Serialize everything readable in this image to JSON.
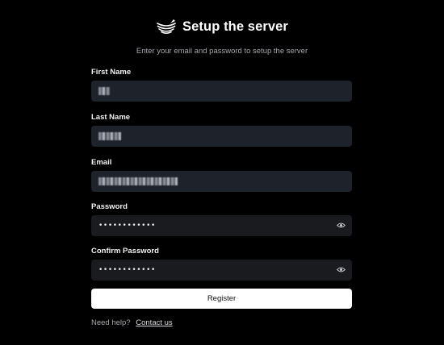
{
  "header": {
    "title": "Setup the server",
    "logo_icon": "layered-bowl-logo-icon"
  },
  "subtitle": "Enter your email and password to setup the server",
  "fields": [
    {
      "label": "First Name",
      "value": "",
      "value_obscured": true
    },
    {
      "label": "Last Name",
      "value": "",
      "value_obscured": true
    },
    {
      "label": "Email",
      "value": "",
      "value_obscured": true
    },
    {
      "label": "Password",
      "value": "••••••••••••",
      "toggle_icon": "eye-icon"
    },
    {
      "label": "Confirm Password",
      "value": "••••••••••••",
      "toggle_icon": "eye-icon"
    }
  ],
  "register_label": "Register",
  "help": {
    "prefix": "Need help?",
    "link_label": "Contact us"
  },
  "colors": {
    "background": "#000000",
    "input_background": "#1e232b",
    "button_background": "#ffffff",
    "muted_text": "#a3a6ab"
  }
}
